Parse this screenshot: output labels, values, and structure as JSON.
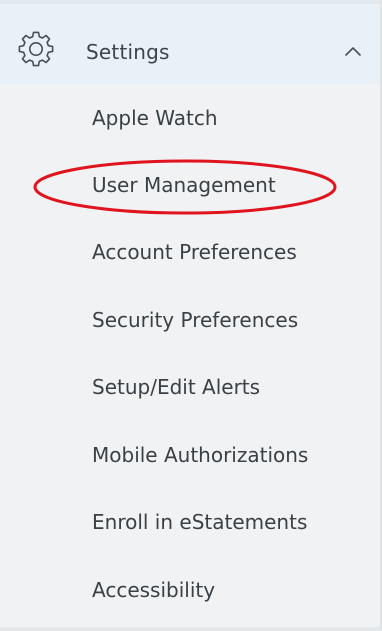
{
  "settings_section": {
    "title": "Settings",
    "icon": "gear-icon",
    "expanded_icon": "chevron-up-icon",
    "items": [
      {
        "label": "Apple Watch"
      },
      {
        "label": "User Management"
      },
      {
        "label": "Account Preferences"
      },
      {
        "label": "Security Preferences"
      },
      {
        "label": "Setup/Edit Alerts"
      },
      {
        "label": "Mobile Authorizations"
      },
      {
        "label": "Enroll in eStatements"
      },
      {
        "label": "Accessibility"
      }
    ]
  },
  "annotation": {
    "shape": "ellipse",
    "color": "#e0141e",
    "target": "User Management"
  }
}
